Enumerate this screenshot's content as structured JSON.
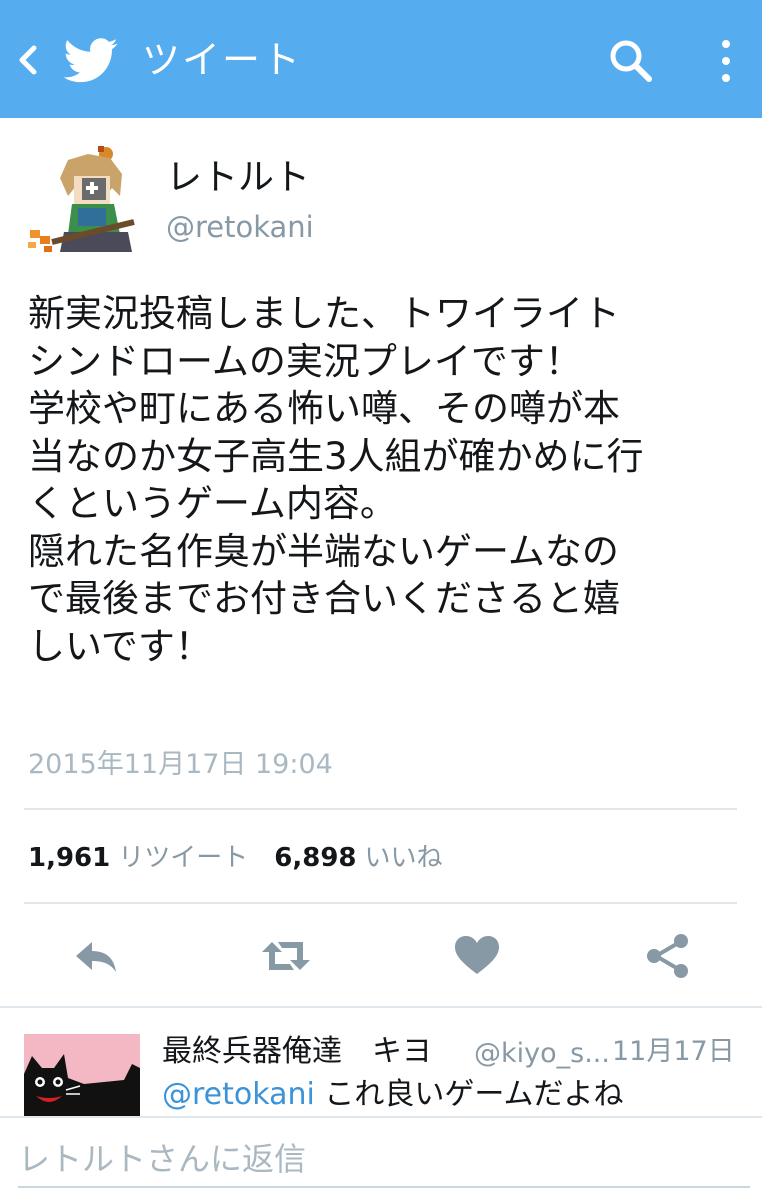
{
  "header": {
    "title": "ツイート",
    "back_icon": "back-chevron-icon",
    "logo_icon": "twitter-bird-icon",
    "search_icon": "search-icon",
    "more_icon": "overflow-menu-icon",
    "bar_color": "#55acee"
  },
  "tweet": {
    "author_name": "レトルト",
    "author_handle": "@retokani",
    "text_lines": [
      "新実況投稿しました、トワイライト",
      "シンドロームの実況プレイです！",
      "学校や町にある怖い噂、その噂が本",
      "当なのか女子高生3人組が確かめに行",
      "くというゲーム内容。",
      "隠れた名作臭が半端ないゲームなの",
      "で最後までお付き合いくださると嬉",
      "しいです！"
    ],
    "timestamp": "2015年11月17日 19:04",
    "retweet_count": "1,961",
    "retweet_label": "リツイート",
    "like_count": "6,898",
    "like_label": "いいね",
    "actions": [
      "reply-icon",
      "retweet-icon",
      "heart-icon",
      "share-icon"
    ],
    "action_color": "#8899a6"
  },
  "reply_preview": {
    "name": "最終兵器俺達　キヨ",
    "handle": "@kiyo_s...",
    "date": "11月17日",
    "mention": "@retokani",
    "text": " これ良いゲームだよね"
  },
  "reply_box": {
    "placeholder": "レトルトさんに返信"
  }
}
